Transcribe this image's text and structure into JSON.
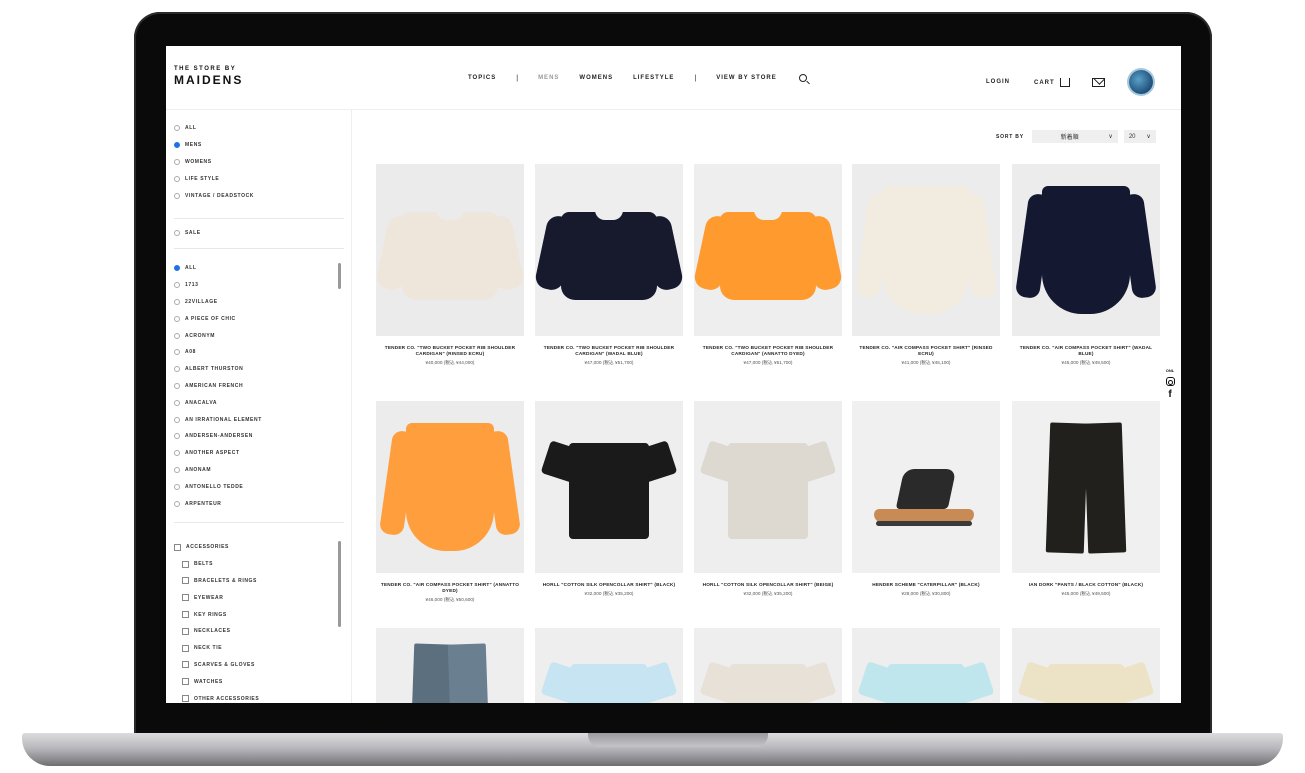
{
  "header": {
    "logo_small": "THE STORE BY",
    "logo_big": "MAIDENS",
    "nav": [
      {
        "label": "TOPICS",
        "active": false
      },
      {
        "label": "MENS",
        "active": true
      },
      {
        "label": "WOMENS",
        "active": false
      },
      {
        "label": "LIFESTYLE",
        "active": false
      },
      {
        "label": "VIEW BY STORE",
        "active": false
      }
    ],
    "separator": "|",
    "login_label": "LOGIN",
    "cart_label": "CART",
    "icons": {
      "search": "search-icon",
      "cart": "cart-icon",
      "mail": "mail-icon",
      "lang": "globe-icon"
    }
  },
  "sidebar": {
    "category_filters": [
      {
        "label": "ALL",
        "selected": false
      },
      {
        "label": "MENS",
        "selected": true
      },
      {
        "label": "WOMENS",
        "selected": false
      },
      {
        "label": "LIFE STYLE",
        "selected": false
      },
      {
        "label": "VINTAGE / DEADSTOCK",
        "selected": false
      }
    ],
    "sale_label": "SALE",
    "brand_filters": [
      {
        "label": "ALL",
        "selected": true
      },
      {
        "label": "1713",
        "selected": false
      },
      {
        "label": "22VILLAGE",
        "selected": false
      },
      {
        "label": "A PIECE OF CHIC",
        "selected": false
      },
      {
        "label": "ACRONYM",
        "selected": false
      },
      {
        "label": "A08",
        "selected": false
      },
      {
        "label": "ALBERT THURSTON",
        "selected": false
      },
      {
        "label": "AMERICAN FRENCH",
        "selected": false
      },
      {
        "label": "ANACALVA",
        "selected": false
      },
      {
        "label": "AN IRRATIONAL ELEMENT",
        "selected": false
      },
      {
        "label": "ANDERSEN-ANDERSEN",
        "selected": false
      },
      {
        "label": "ANOTHER ASPECT",
        "selected": false
      },
      {
        "label": "ANONAM",
        "selected": false
      },
      {
        "label": "ANTONELLO TEDDE",
        "selected": false
      },
      {
        "label": "ARPENTEUR",
        "selected": false
      }
    ],
    "item_filters": [
      {
        "label": "ACCESSORIES",
        "sub": false
      },
      {
        "label": "BELTS",
        "sub": true
      },
      {
        "label": "BRACELETS & RINGS",
        "sub": true
      },
      {
        "label": "EYEWEAR",
        "sub": true
      },
      {
        "label": "KEY RINGS",
        "sub": true
      },
      {
        "label": "NECKLACES",
        "sub": true
      },
      {
        "label": "NECK TIE",
        "sub": true
      },
      {
        "label": "SCARVES & GLOVES",
        "sub": true
      },
      {
        "label": "WATCHES",
        "sub": true
      },
      {
        "label": "OTHER ACCESSORIES",
        "sub": true
      }
    ]
  },
  "sort": {
    "label": "SORT BY",
    "selected": "新着順",
    "per_page": "20"
  },
  "products": [
    {
      "name": "TENDER CO. \"TWO BUCKET POCKET RIB SHOULDER CARDIGAN\" (RINSED ECRU)",
      "price": "¥40,000 (税込 ¥44,000)",
      "shape": "cardigan",
      "color": "#efe6db",
      "bg": "#ebebeb"
    },
    {
      "name": "TENDER CO. \"TWO BUCKET POCKET RIB SHOULDER CARDIGAN\" (WADAL BLUE)",
      "price": "¥47,000 (税込 ¥51,700)",
      "shape": "cardigan",
      "color": "#161a2c",
      "bg": "#eeeeee"
    },
    {
      "name": "TENDER CO. \"TWO BUCKET POCKET RIB SHOULDER CARDIGAN\" (ANNATTO DYED)",
      "price": "¥47,000 (税込 ¥51,700)",
      "shape": "cardigan",
      "color": "#ff9a2e",
      "bg": "#eeeeee"
    },
    {
      "name": "TENDER CO. \"AIR COMPASS POCKET SHIRT\" (RINSED ECRU)",
      "price": "¥41,000 (税込 ¥45,100)",
      "shape": "longshirt",
      "color": "#f2ebdf",
      "bg": "#ececec"
    },
    {
      "name": "TENDER CO. \"AIR COMPASS POCKET SHIRT\" (WADAL BLUE)",
      "price": "¥45,000 (税込 ¥49,500)",
      "shape": "longshirt",
      "color": "#141830",
      "bg": "#ececec"
    },
    {
      "name": "TENDER CO. \"AIR COMPASS POCKET SHIRT\" (ANNATTO DYED)",
      "price": "¥46,000 (税込 ¥50,600)",
      "shape": "longshirt",
      "color": "#ff9e3c",
      "bg": "#ececec"
    },
    {
      "name": "HORLL \"COTTON SILK OPENCOLLAR SHIRT\" (BLACK)",
      "price": "¥32,000 (税込 ¥35,200)",
      "shape": "shortshirt",
      "color": "#1a1a1a",
      "bg": "#eeeeee"
    },
    {
      "name": "HORLL \"COTTON SILK OPENCOLLAR SHIRT\" (BEIGE)",
      "price": "¥32,000 (税込 ¥35,200)",
      "shape": "shortshirt",
      "color": "#ddd9d0",
      "bg": "#eeeeee"
    },
    {
      "name": "HENDER SCHEME \"CATERPILLAR\" (BLACK)",
      "price": "¥28,000 (税込 ¥30,800)",
      "shape": "sandal",
      "color": "#2a2a2a",
      "bg": "#f0f0f0"
    },
    {
      "name": "IAN DORK \"PANTS / BLACK COTTON\" (BLACK)",
      "price": "¥45,000 (税込 ¥49,500)",
      "shape": "pants",
      "color": "#22201c",
      "bg": "#f0f0f0"
    },
    {
      "name": "",
      "price": "",
      "shape": "jeans",
      "color": "#5c6f7e",
      "bg": "#eeeeee"
    },
    {
      "name": "",
      "price": "",
      "shape": "topshirt",
      "color": "#c6e4f2",
      "bg": "#eeeeee"
    },
    {
      "name": "",
      "price": "",
      "shape": "topshirt",
      "color": "#e8e1d8",
      "bg": "#eeeeee"
    },
    {
      "name": "",
      "price": "",
      "shape": "topshirt",
      "color": "#bfe6ec",
      "bg": "#eeeeee"
    },
    {
      "name": "",
      "price": "",
      "shape": "topshirt",
      "color": "#ece3c7",
      "bg": "#eeeeee"
    }
  ],
  "social": {
    "label": "ONL",
    "icons": [
      "instagram-icon",
      "facebook-icon"
    ],
    "facebook_glyph": "f"
  }
}
